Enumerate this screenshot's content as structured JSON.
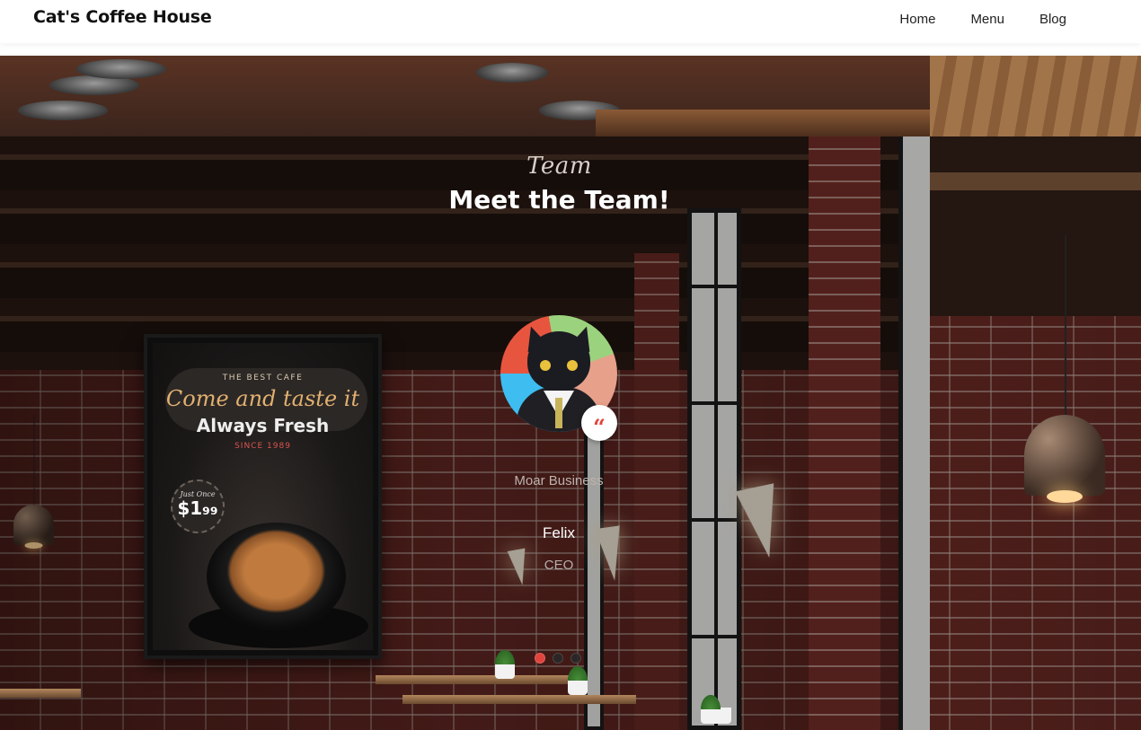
{
  "header": {
    "brand": "Cat's Coffee House",
    "nav": [
      {
        "label": "Home"
      },
      {
        "label": "Menu"
      },
      {
        "label": "Blog"
      }
    ]
  },
  "poster": {
    "tagline_top": "THE BEST CAFE",
    "headline": "Come and taste it",
    "subheadline": "Always Fresh",
    "since": "SINCE 1989",
    "price_prefix": "Just Once",
    "price": "$1₉₉"
  },
  "team": {
    "script_title": "Team",
    "title": "Meet the Team!",
    "testimonial": "Moar Business",
    "member_name": "Felix",
    "member_role": "CEO",
    "quote_icon": "quote-icon",
    "slides": 3,
    "active_slide": 1
  },
  "colors": {
    "accent": "#e0443e",
    "nav_bg": "#ffffff",
    "text_light": "#ffffff"
  }
}
